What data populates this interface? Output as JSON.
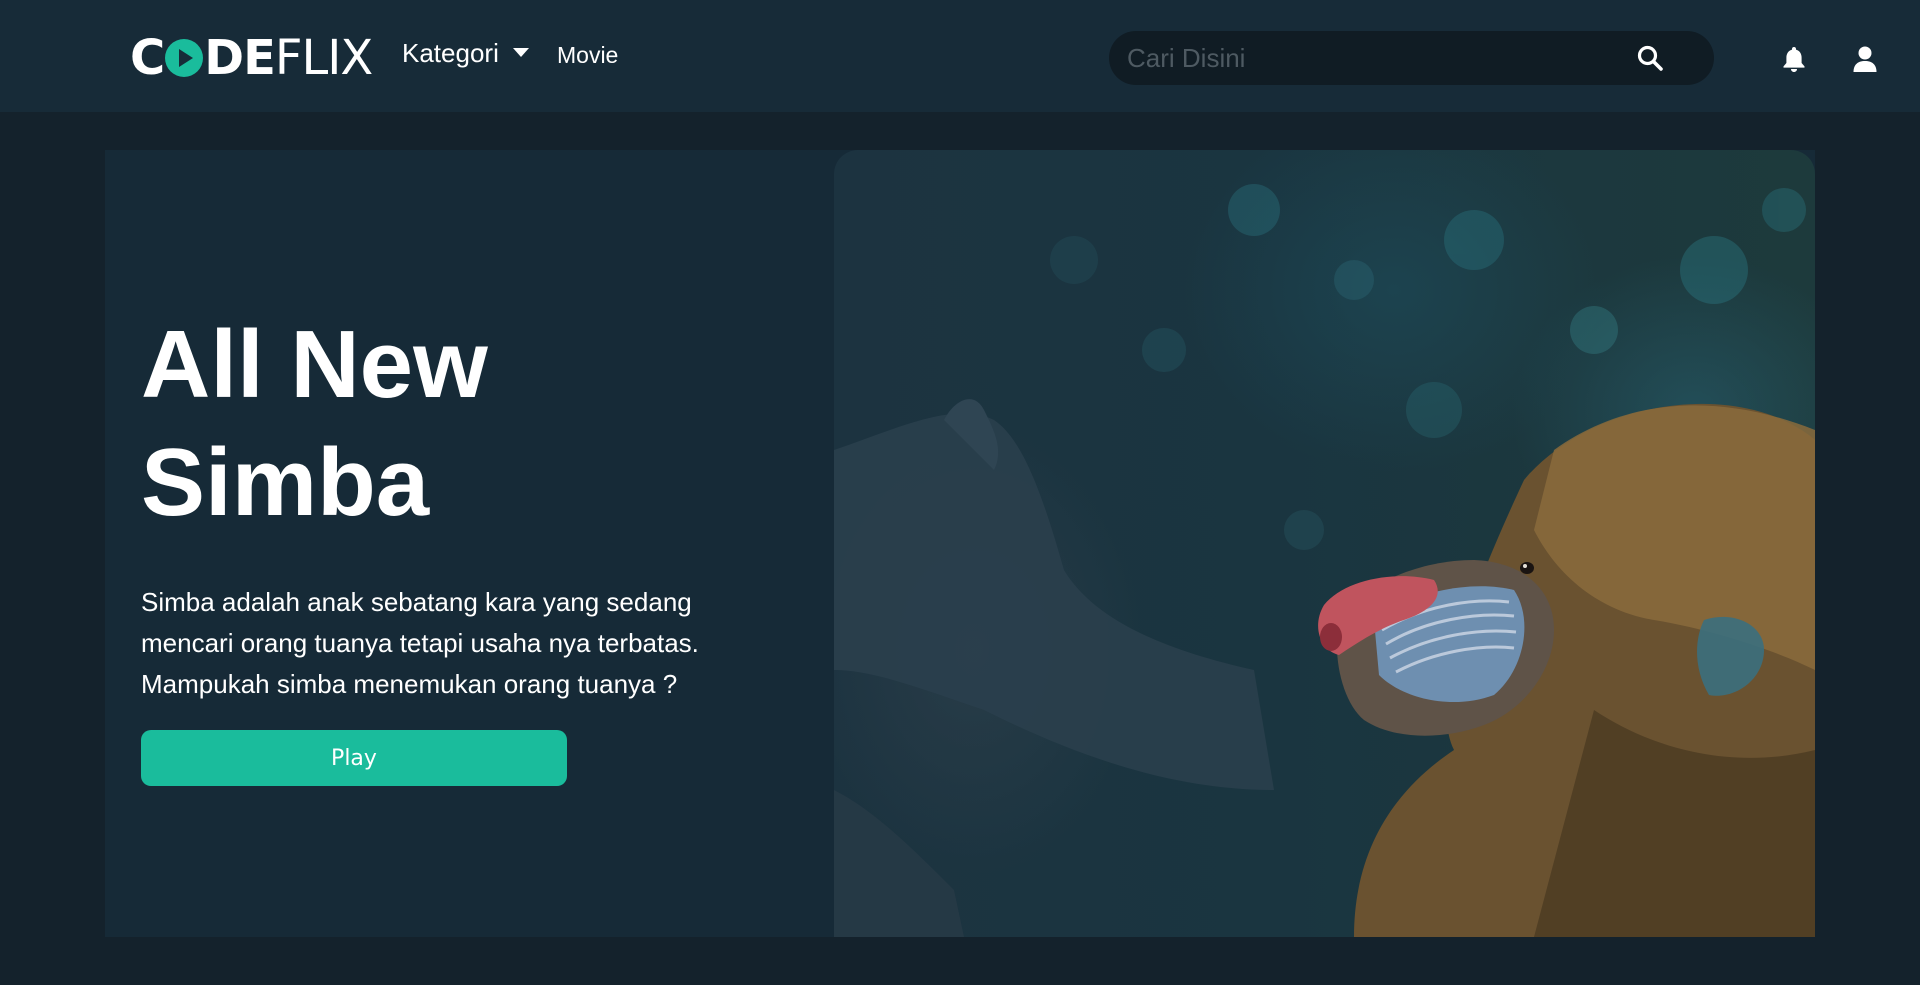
{
  "brand": {
    "logo_first": "C",
    "logo_mid": "DE",
    "logo_last": "FLIX",
    "accent_color": "#1abc9c"
  },
  "nav": {
    "kategori_label": "Kategori",
    "movie_label": "Movie"
  },
  "search": {
    "placeholder": "Cari Disini",
    "value": "",
    "icon": "search-icon"
  },
  "header_icons": {
    "notifications": "bell-icon",
    "profile": "user-icon"
  },
  "hero": {
    "title": "All New Simba",
    "description": "Simba adalah anak sebatang kara yang sedang mencari orang tuanya tetapi usaha nya terbatas. Mampukah simba menemukan orang tuanya ?",
    "play_label": "Play",
    "image_subject": "mandrill"
  },
  "colors": {
    "page_bg": "#14222c",
    "navbar_bg": "#172b38",
    "hero_bg": "#162a37",
    "search_bg": "#101c24"
  }
}
